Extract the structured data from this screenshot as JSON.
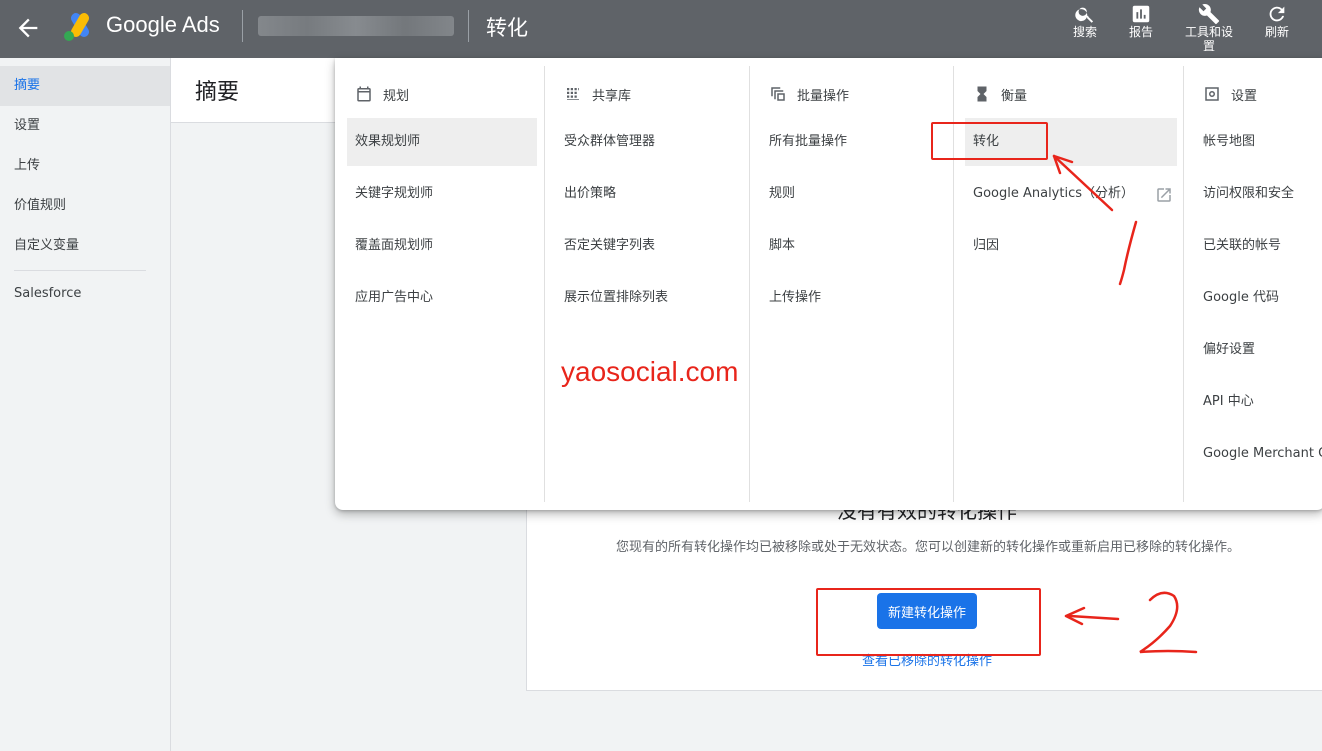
{
  "topbar": {
    "brand": "Google Ads",
    "page_title": "转化",
    "actions": {
      "search": "搜索",
      "reports": "报告",
      "tools_line1": "工具和设",
      "tools_line2": "置",
      "refresh": "刷新"
    }
  },
  "leftnav": {
    "items": [
      {
        "label": "摘要"
      },
      {
        "label": "设置"
      },
      {
        "label": "上传"
      },
      {
        "label": "价值规则"
      },
      {
        "label": "自定义变量"
      },
      {
        "label": "Salesforce"
      }
    ]
  },
  "main": {
    "summary_title": "摘要",
    "card": {
      "title": "没有有效的转化操作",
      "desc": "您现有的所有转化操作均已被移除或处于无效状态。您可以创建新的转化操作或重新启用已移除的转化操作。",
      "new_button": "新建转化操作",
      "view_removed_link": "查看已移除的转化操作"
    }
  },
  "menu": {
    "columns": [
      {
        "heading": "规划",
        "icon": "calendar-icon",
        "items": [
          "效果规划师",
          "关键字规划师",
          "覆盖面规划师",
          "应用广告中心"
        ]
      },
      {
        "heading": "共享库",
        "icon": "library-icon",
        "items": [
          "受众群体管理器",
          "出价策略",
          "否定关键字列表",
          "展示位置排除列表"
        ]
      },
      {
        "heading": "批量操作",
        "icon": "bulk-actions-icon",
        "items": [
          "所有批量操作",
          "规则",
          "脚本",
          "上传操作"
        ]
      },
      {
        "heading": "衡量",
        "icon": "hourglass-icon",
        "items": [
          "转化",
          "Google Analytics（分析）",
          "归因"
        ]
      },
      {
        "heading": "设置",
        "icon": "settings-icon",
        "items": [
          "帐号地图",
          "访问权限和安全",
          "已关联的帐号",
          "Google 代码",
          "偏好设置",
          "API 中心",
          "Google Merchant Center"
        ]
      }
    ]
  },
  "annotations": {
    "watermark": "yaosocial.com",
    "step1": "1",
    "step2": "2",
    "color": "#e8251b"
  },
  "colors": {
    "topbar": "#5f6368",
    "accent": "#1a73e8"
  }
}
